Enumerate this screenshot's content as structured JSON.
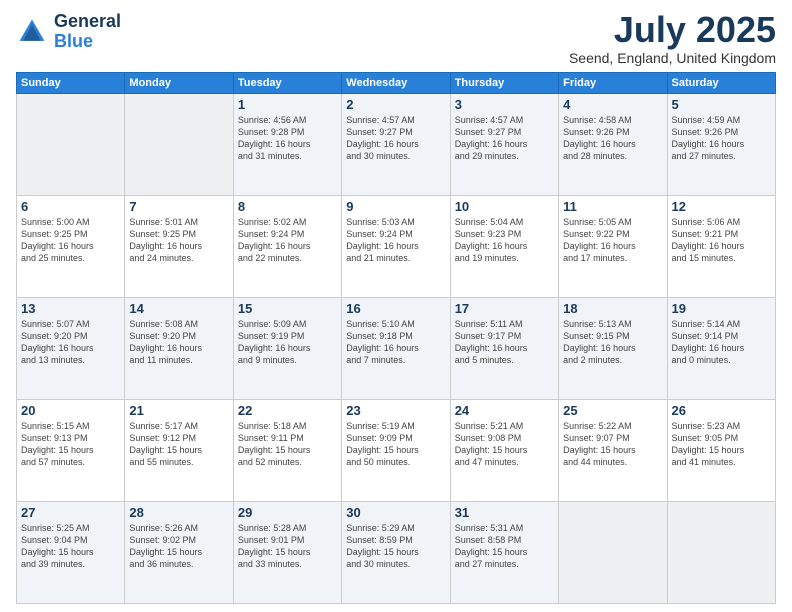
{
  "header": {
    "logo_general": "General",
    "logo_blue": "Blue",
    "month_title": "July 2025",
    "subtitle": "Seend, England, United Kingdom"
  },
  "weekdays": [
    "Sunday",
    "Monday",
    "Tuesday",
    "Wednesday",
    "Thursday",
    "Friday",
    "Saturday"
  ],
  "weeks": [
    [
      {
        "day": "",
        "info": ""
      },
      {
        "day": "",
        "info": ""
      },
      {
        "day": "1",
        "info": "Sunrise: 4:56 AM\nSunset: 9:28 PM\nDaylight: 16 hours\nand 31 minutes."
      },
      {
        "day": "2",
        "info": "Sunrise: 4:57 AM\nSunset: 9:27 PM\nDaylight: 16 hours\nand 30 minutes."
      },
      {
        "day": "3",
        "info": "Sunrise: 4:57 AM\nSunset: 9:27 PM\nDaylight: 16 hours\nand 29 minutes."
      },
      {
        "day": "4",
        "info": "Sunrise: 4:58 AM\nSunset: 9:26 PM\nDaylight: 16 hours\nand 28 minutes."
      },
      {
        "day": "5",
        "info": "Sunrise: 4:59 AM\nSunset: 9:26 PM\nDaylight: 16 hours\nand 27 minutes."
      }
    ],
    [
      {
        "day": "6",
        "info": "Sunrise: 5:00 AM\nSunset: 9:25 PM\nDaylight: 16 hours\nand 25 minutes."
      },
      {
        "day": "7",
        "info": "Sunrise: 5:01 AM\nSunset: 9:25 PM\nDaylight: 16 hours\nand 24 minutes."
      },
      {
        "day": "8",
        "info": "Sunrise: 5:02 AM\nSunset: 9:24 PM\nDaylight: 16 hours\nand 22 minutes."
      },
      {
        "day": "9",
        "info": "Sunrise: 5:03 AM\nSunset: 9:24 PM\nDaylight: 16 hours\nand 21 minutes."
      },
      {
        "day": "10",
        "info": "Sunrise: 5:04 AM\nSunset: 9:23 PM\nDaylight: 16 hours\nand 19 minutes."
      },
      {
        "day": "11",
        "info": "Sunrise: 5:05 AM\nSunset: 9:22 PM\nDaylight: 16 hours\nand 17 minutes."
      },
      {
        "day": "12",
        "info": "Sunrise: 5:06 AM\nSunset: 9:21 PM\nDaylight: 16 hours\nand 15 minutes."
      }
    ],
    [
      {
        "day": "13",
        "info": "Sunrise: 5:07 AM\nSunset: 9:20 PM\nDaylight: 16 hours\nand 13 minutes."
      },
      {
        "day": "14",
        "info": "Sunrise: 5:08 AM\nSunset: 9:20 PM\nDaylight: 16 hours\nand 11 minutes."
      },
      {
        "day": "15",
        "info": "Sunrise: 5:09 AM\nSunset: 9:19 PM\nDaylight: 16 hours\nand 9 minutes."
      },
      {
        "day": "16",
        "info": "Sunrise: 5:10 AM\nSunset: 9:18 PM\nDaylight: 16 hours\nand 7 minutes."
      },
      {
        "day": "17",
        "info": "Sunrise: 5:11 AM\nSunset: 9:17 PM\nDaylight: 16 hours\nand 5 minutes."
      },
      {
        "day": "18",
        "info": "Sunrise: 5:13 AM\nSunset: 9:15 PM\nDaylight: 16 hours\nand 2 minutes."
      },
      {
        "day": "19",
        "info": "Sunrise: 5:14 AM\nSunset: 9:14 PM\nDaylight: 16 hours\nand 0 minutes."
      }
    ],
    [
      {
        "day": "20",
        "info": "Sunrise: 5:15 AM\nSunset: 9:13 PM\nDaylight: 15 hours\nand 57 minutes."
      },
      {
        "day": "21",
        "info": "Sunrise: 5:17 AM\nSunset: 9:12 PM\nDaylight: 15 hours\nand 55 minutes."
      },
      {
        "day": "22",
        "info": "Sunrise: 5:18 AM\nSunset: 9:11 PM\nDaylight: 15 hours\nand 52 minutes."
      },
      {
        "day": "23",
        "info": "Sunrise: 5:19 AM\nSunset: 9:09 PM\nDaylight: 15 hours\nand 50 minutes."
      },
      {
        "day": "24",
        "info": "Sunrise: 5:21 AM\nSunset: 9:08 PM\nDaylight: 15 hours\nand 47 minutes."
      },
      {
        "day": "25",
        "info": "Sunrise: 5:22 AM\nSunset: 9:07 PM\nDaylight: 15 hours\nand 44 minutes."
      },
      {
        "day": "26",
        "info": "Sunrise: 5:23 AM\nSunset: 9:05 PM\nDaylight: 15 hours\nand 41 minutes."
      }
    ],
    [
      {
        "day": "27",
        "info": "Sunrise: 5:25 AM\nSunset: 9:04 PM\nDaylight: 15 hours\nand 39 minutes."
      },
      {
        "day": "28",
        "info": "Sunrise: 5:26 AM\nSunset: 9:02 PM\nDaylight: 15 hours\nand 36 minutes."
      },
      {
        "day": "29",
        "info": "Sunrise: 5:28 AM\nSunset: 9:01 PM\nDaylight: 15 hours\nand 33 minutes."
      },
      {
        "day": "30",
        "info": "Sunrise: 5:29 AM\nSunset: 8:59 PM\nDaylight: 15 hours\nand 30 minutes."
      },
      {
        "day": "31",
        "info": "Sunrise: 5:31 AM\nSunset: 8:58 PM\nDaylight: 15 hours\nand 27 minutes."
      },
      {
        "day": "",
        "info": ""
      },
      {
        "day": "",
        "info": ""
      }
    ]
  ]
}
